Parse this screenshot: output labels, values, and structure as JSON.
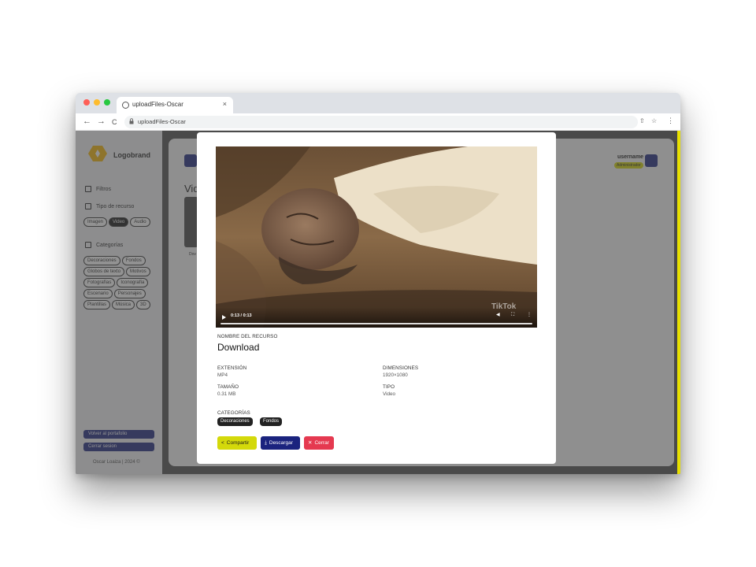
{
  "browser": {
    "tab_title": "uploadFiles-Oscar",
    "tab_close": "×",
    "url": "uploadFiles-Oscar",
    "nav": {
      "back": "←",
      "forward": "→",
      "reload": "C"
    },
    "tools": {
      "share": "⇧",
      "star": "☆",
      "menu": "⋮"
    }
  },
  "sidebar": {
    "brand": "Logobrand",
    "filters_label": "Filtros",
    "resource_type_label": "Tipo de recurso",
    "resource_types": [
      {
        "label": "Imagen",
        "active": false
      },
      {
        "label": "Video",
        "active": true
      },
      {
        "label": "Audio",
        "active": false
      }
    ],
    "categories_label": "Categorías",
    "categories": [
      "Decoraciones",
      "Fondos",
      "Globos de texto",
      "Motivos",
      "Fotografías",
      "Iconografía",
      "Escenario",
      "Personajes",
      "Plantillas",
      "Música",
      "3D"
    ],
    "portfolio_button": "Volver al portafolio",
    "logout_button": "Cerrar sesion",
    "copyright": "Oscar Loaiza | 2024 ©"
  },
  "main": {
    "heading": "Vid",
    "thumb_label": "Dov",
    "username": "username",
    "user_role": "Administrador"
  },
  "modal": {
    "video": {
      "time": "0:13 / 0:13",
      "watermark": "TikTok",
      "progress": 1.0
    },
    "resource_name_label": "NOMBRE DEL RECURSO",
    "resource_name": "Download",
    "extension_label": "EXTENSIÓN",
    "extension": "MP4",
    "dimensions_label": "DIMENSIONES",
    "dimensions": "1920×1080",
    "size_label": "TAMAÑO",
    "size": "0.31 MB",
    "type_label": "TIPO",
    "type": "Video",
    "categories_label": "CATEGORÍAS",
    "categories": [
      "Decoraciones",
      "Fondos"
    ],
    "share_button": "Compartir",
    "download_button": "Descargar",
    "close_button": "Cerrar"
  },
  "colors": {
    "accent_navy": "#1a237e",
    "accent_yellow": "#d4d90a",
    "danger_red": "#e53950"
  }
}
